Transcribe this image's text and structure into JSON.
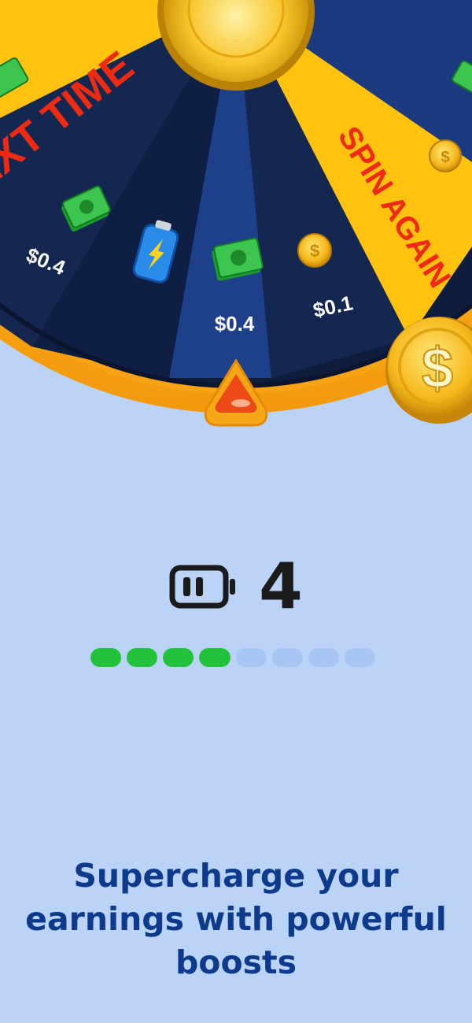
{
  "wheel": {
    "segments": [
      {
        "label": "NEXT TIME",
        "type": "text"
      },
      {
        "label": "$0.4",
        "type": "cash"
      },
      {
        "label": "",
        "type": "battery"
      },
      {
        "label": "$0.4",
        "type": "cash"
      },
      {
        "label": "$0.1",
        "type": "coin"
      },
      {
        "label": "SPIN AGAIN",
        "type": "text"
      }
    ]
  },
  "energy": {
    "icon": "battery-icon",
    "count": "4",
    "filled": 4,
    "total": 8,
    "colors": {
      "filled": "#22c23a",
      "empty": "#a9c5f4"
    }
  },
  "headline": "Supercharge your earnings with powerful boosts",
  "colors": {
    "background": "#bcd3f8",
    "headline": "#0e3a8c",
    "wheel_navy": "#13264f",
    "wheel_yellow": "#ffc20e"
  }
}
